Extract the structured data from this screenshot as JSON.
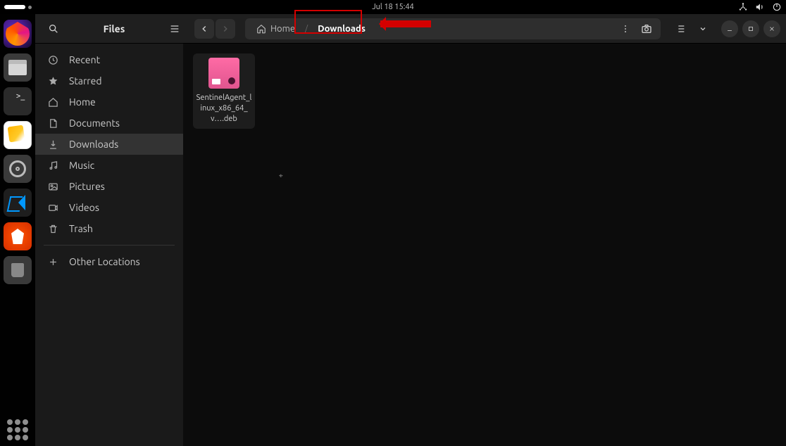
{
  "panel": {
    "datetime": "Jul 18  15:44"
  },
  "dock": {
    "firefox": "Firefox",
    "files": "Files",
    "terminal": "Terminal",
    "text_editor": "Text Editor",
    "settings": "Settings",
    "vscode": "Visual Studio Code",
    "brave": "Brave",
    "trash": "Trash",
    "show_apps": "Show Applications",
    "term_prompt": ">_"
  },
  "header": {
    "title": "Files"
  },
  "breadcrumb": {
    "home": "Home",
    "current": "Downloads"
  },
  "sidebar": {
    "items": [
      {
        "label": "Recent"
      },
      {
        "label": "Starred"
      },
      {
        "label": "Home"
      },
      {
        "label": "Documents"
      },
      {
        "label": "Downloads"
      },
      {
        "label": "Music"
      },
      {
        "label": "Pictures"
      },
      {
        "label": "Videos"
      },
      {
        "label": "Trash"
      }
    ],
    "other": "Other Locations"
  },
  "files": [
    {
      "name": "SentinelAgent_linux_x86_64_v….deb"
    }
  ]
}
